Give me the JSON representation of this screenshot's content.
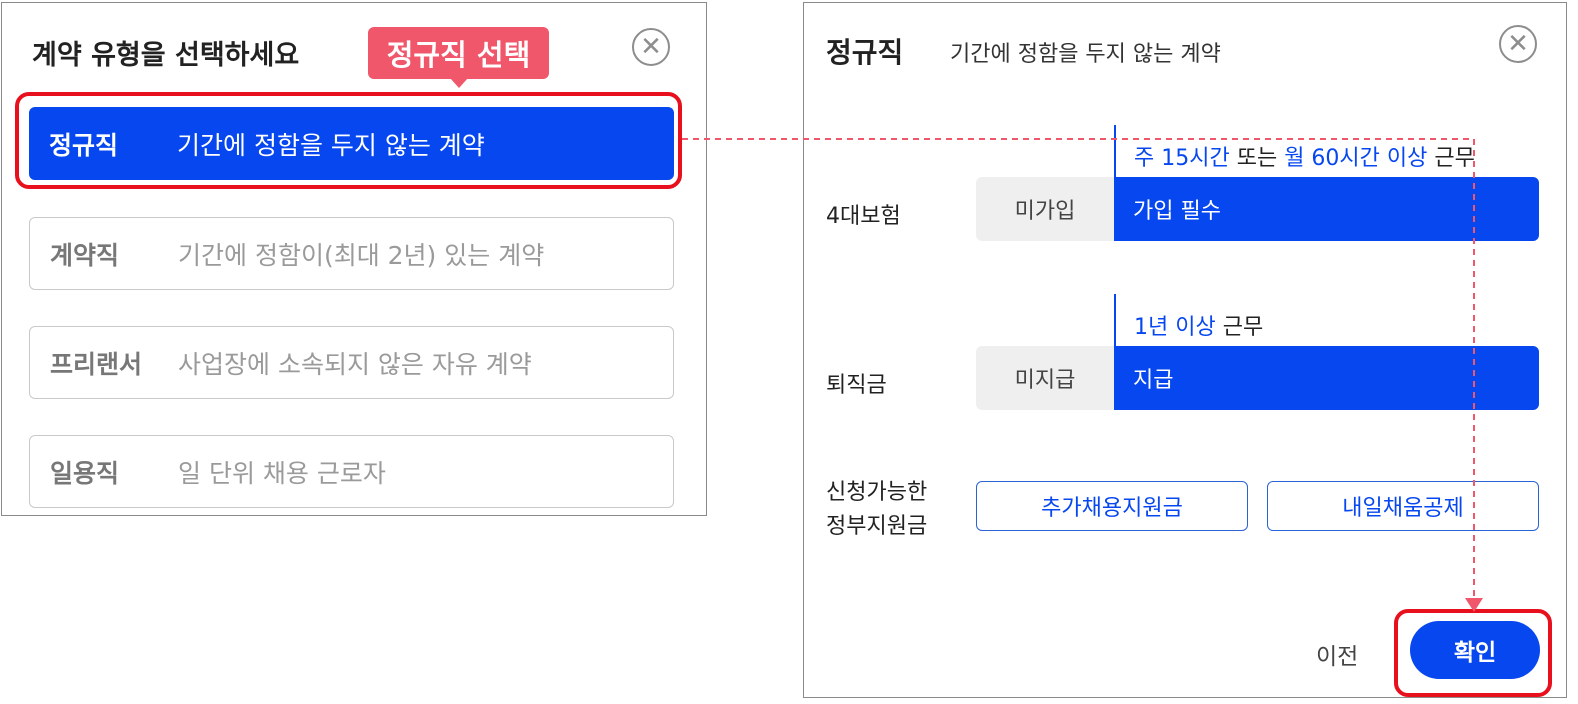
{
  "left": {
    "title": "계약 유형을 선택하세요",
    "tooltip": "정규직 선택",
    "close_icon": "close-circle-icon",
    "options": [
      {
        "name": "정규직",
        "desc": "기간에 정함을 두지 않는 계약",
        "selected": true
      },
      {
        "name": "계약직",
        "desc": "기간에 정함이(최대 2년) 있는 계약",
        "selected": false
      },
      {
        "name": "프리랜서",
        "desc": "사업장에 소속되지 않은 자유 계약",
        "selected": false
      },
      {
        "name": "일용직",
        "desc": "일 단위 채용 근로자",
        "selected": false
      }
    ]
  },
  "right": {
    "title": "정규직",
    "subtitle": "기간에 정함을 두지 않는 계약",
    "close_icon": "close-circle-icon",
    "insurance": {
      "label": "4대보험",
      "condition_parts": [
        "주 15시간",
        " 또는 ",
        "월 60시간 이상",
        " 근무"
      ],
      "left_option": "미가입",
      "right_option": "가입 필수"
    },
    "severance": {
      "label": "퇴직금",
      "condition_parts": [
        "1년 이상",
        " 근무"
      ],
      "left_option": "미지급",
      "right_option": "지급"
    },
    "subsidy": {
      "label_line1": "신청가능한",
      "label_line2": "정부지원금",
      "buttons": [
        "추가채용지원금",
        "내일채움공제"
      ]
    },
    "prev_label": "이전",
    "confirm_label": "확인"
  },
  "colors": {
    "primary_blue": "#0747f0",
    "highlight_red": "#e8101c",
    "tooltip_pink": "#f0576b",
    "dashed_arrow": "#f0576b"
  }
}
